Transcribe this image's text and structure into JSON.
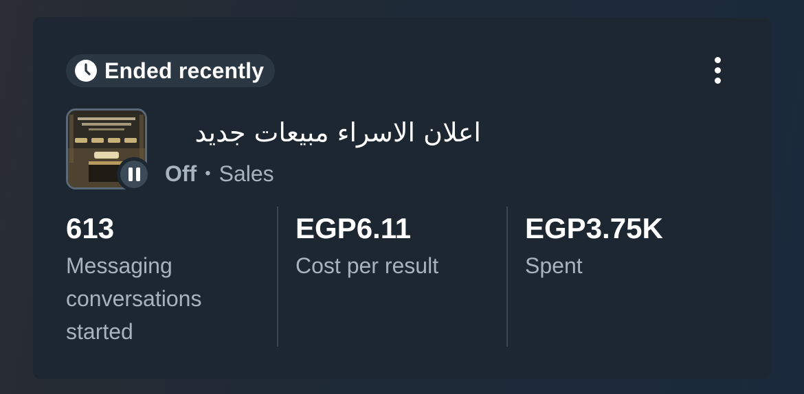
{
  "status": {
    "label": "Ended recently",
    "icon": "clock-icon"
  },
  "menu": {
    "icon": "more-vertical-icon"
  },
  "ad": {
    "name": "اعلان الاسراء مبيعات جديد",
    "state": "Off",
    "separator": "•",
    "objective": "Sales",
    "thumbnail_icon": "ad-thumbnail",
    "state_icon": "pause-icon"
  },
  "metrics": [
    {
      "value": "613",
      "label": "Messaging conversations started"
    },
    {
      "value": "EGP6.11",
      "label": "Cost per result"
    },
    {
      "value": "EGP3.75K",
      "label": "Spent"
    }
  ],
  "colors": {
    "card_background": "#1d2731",
    "pill_background": "#2b3843",
    "secondary_text": "#a7b3bf",
    "divider": "#3a4753"
  }
}
